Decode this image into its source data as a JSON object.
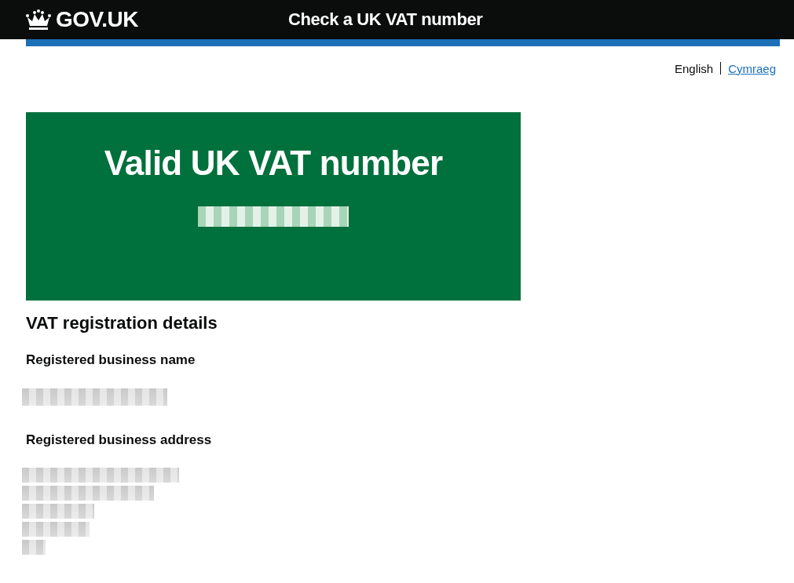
{
  "header": {
    "logo_text": "GOV.UK",
    "service_name": "Check a UK VAT number"
  },
  "language_toggle": [
    {
      "label": "English",
      "selected": true
    },
    {
      "label": "Cymraeg",
      "selected": false
    }
  ],
  "panel": {
    "title": "Valid UK VAT number",
    "vat_number": {
      "kind": "redacted"
    }
  },
  "details": {
    "heading": "VAT registration details",
    "fields": [
      {
        "label": "Registered business name",
        "lines": [
          {
            "kind": "redacted"
          }
        ]
      },
      {
        "label": "Registered business address",
        "lines": [
          {
            "kind": "redacted"
          },
          {
            "kind": "redacted"
          },
          {
            "kind": "redacted"
          },
          {
            "kind": "redacted"
          },
          {
            "kind": "redacted"
          }
        ]
      }
    ]
  }
}
